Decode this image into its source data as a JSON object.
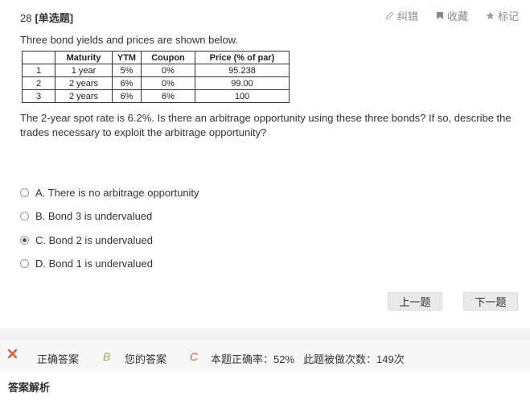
{
  "question": {
    "number": "28",
    "type": "[单选题]",
    "intro": "Three bond yields and prices are shown below.",
    "text": "The 2-year spot rate is 6.2%. Is there an arbitrage opportunity using these three bonds? If so, describe the trades necessary to exploit the arbitrage opportunity?"
  },
  "tools": {
    "report": "纠错",
    "favorite": "收藏",
    "mark": "标记"
  },
  "table": {
    "headers": [
      "",
      "Maturity",
      "YTM",
      "Coupon",
      "Price (% of par)"
    ],
    "rows": [
      [
        "1",
        "1 year",
        "5%",
        "0%",
        "95.238"
      ],
      [
        "2",
        "2 years",
        "6%",
        "0%",
        "99.00"
      ],
      [
        "3",
        "2 years",
        "6%",
        "6%",
        "100"
      ]
    ]
  },
  "options": [
    {
      "text": "A. There is no arbitrage opportunity",
      "selected": false
    },
    {
      "text": "B. Bond 3 is undervalued",
      "selected": false
    },
    {
      "text": "C. Bond 2 is undervalued",
      "selected": true
    },
    {
      "text": "D. Bond 1 is undervalued",
      "selected": false
    }
  ],
  "nav": {
    "prev": "上一题",
    "next": "下一题"
  },
  "result": {
    "correct_label": "正确答案",
    "correct_answer": "B",
    "your_label": "您的答案",
    "your_answer": "C",
    "accuracy": "本题正确率：52%",
    "attempts": "此题被做次数：149次",
    "status_icon": "close-icon",
    "colors": {
      "correct": "#7fc241",
      "wrong": "#e8562a"
    }
  },
  "analysis_title": "答案解析"
}
